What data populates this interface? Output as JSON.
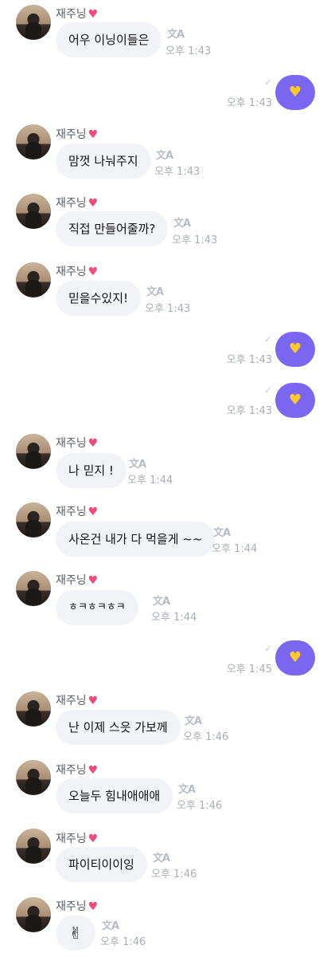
{
  "messages": [
    {
      "type": "in",
      "sender": "재주닝",
      "heart": "♥",
      "text": "어우 이닝이들은",
      "time": "오후 1:43",
      "translate": "文A"
    },
    {
      "type": "out",
      "emoji": "♥",
      "time": "오후 1:43",
      "check": "✓"
    },
    {
      "type": "in",
      "sender": "재주닝",
      "heart": "♥",
      "text": "맘껏 나눠주지",
      "time": "오후 1:43",
      "translate": "文A"
    },
    {
      "type": "in",
      "sender": "재주닝",
      "heart": "♥",
      "text": "직접 만들어줄까?",
      "time": "오후 1:43",
      "translate": "文A"
    },
    {
      "type": "in",
      "sender": "재주닝",
      "heart": "♥",
      "text": "믿을수있지!",
      "time": "오후 1:43",
      "translate": "文A"
    },
    {
      "type": "out",
      "emoji": "♥",
      "time": "오후 1:43",
      "check": "✓"
    },
    {
      "type": "out",
      "emoji": "♥",
      "time": "오후 1:43",
      "check": "✓"
    },
    {
      "type": "in",
      "sender": "재주닝",
      "heart": "♥",
      "text": "나 믿지 !",
      "time": "오후 1:44",
      "translate": "文A"
    },
    {
      "type": "in",
      "sender": "재주닝",
      "heart": "♥",
      "text": "사온건 내가 다 먹을게 ~~",
      "time": "오후 1:44",
      "translate": "文A"
    },
    {
      "type": "in",
      "sender": "재주닝",
      "heart": "♥",
      "text": "ㅎㅋㅎㅋㅎㅋ",
      "time": "오후 1:44",
      "translate": "文A"
    },
    {
      "type": "out",
      "emoji": "♥",
      "time": "오후 1:45",
      "check": "✓"
    },
    {
      "type": "in",
      "sender": "재주닝",
      "heart": "♥",
      "text": "난 이제 스읏 가보께",
      "time": "오후 1:46",
      "translate": "文A"
    },
    {
      "type": "in",
      "sender": "재주닝",
      "heart": "♥",
      "text": "오늘두 힘내애애애",
      "time": "오후 1:46",
      "translate": "文A"
    },
    {
      "type": "in",
      "sender": "재주닝",
      "heart": "♥",
      "text": "파이티이이잉",
      "time": "오후 1:46",
      "translate": "文A"
    },
    {
      "type": "in",
      "sender": "재주닝",
      "heart": "♥",
      "text": "✌",
      "time": "오후 1:46",
      "translate": "文A"
    }
  ]
}
